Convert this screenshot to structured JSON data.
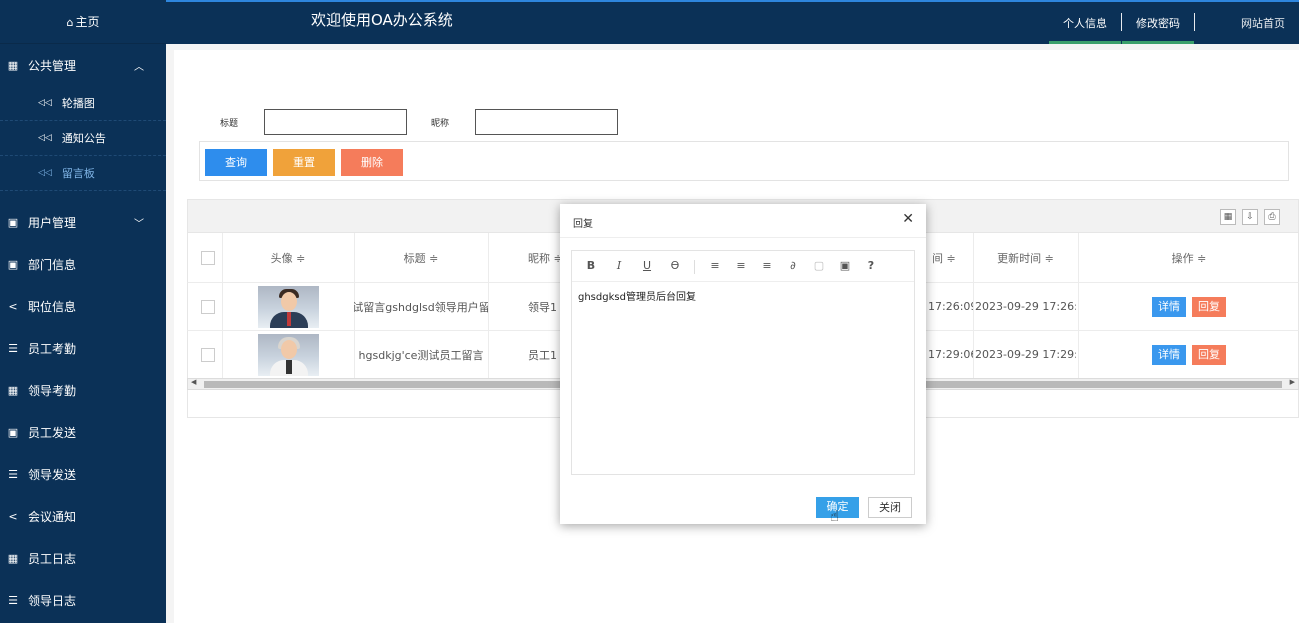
{
  "sidebar": {
    "home": "主页",
    "groups": [
      {
        "label": "公共管理",
        "icon": "grid-icon",
        "expanded": true
      },
      {
        "label": "用户管理",
        "icon": "calendar-icon",
        "expanded": false
      },
      {
        "label": "部门信息",
        "icon": "calendar-icon"
      },
      {
        "label": "职位信息",
        "icon": "share-icon"
      },
      {
        "label": "员工考勤",
        "icon": "list-icon"
      },
      {
        "label": "领导考勤",
        "icon": "grid-icon"
      },
      {
        "label": "员工发送",
        "icon": "calendar-icon"
      },
      {
        "label": "领导发送",
        "icon": "list-icon"
      },
      {
        "label": "会议通知",
        "icon": "share-icon"
      },
      {
        "label": "员工日志",
        "icon": "grid-icon"
      },
      {
        "label": "领导日志",
        "icon": "list-icon"
      }
    ],
    "sub_items": [
      "轮播图",
      "通知公告",
      "留言板"
    ],
    "active_sub": "留言板"
  },
  "header": {
    "title": "欢迎使用OA办公系统",
    "links": [
      "个人信息",
      "修改密码",
      "网站首页"
    ]
  },
  "search": {
    "title_label": "标题",
    "nickname_label": "昵称",
    "title_value": "",
    "nickname_value": "",
    "buttons": {
      "query": "查询",
      "reset": "重置",
      "delete": "删除"
    }
  },
  "table": {
    "columns": [
      "头像 ≑",
      "标题 ≑",
      "昵称 ≑",
      "间 ≑",
      "更新时间 ≑",
      "操作 ≑"
    ],
    "rows": [
      {
        "title": "试留言gshdglsd领导用户留",
        "nickname": "领导1",
        "created": "17:26:09",
        "updated": "2023-09-29 17:26:0",
        "detail": "详情",
        "reply": "回复"
      },
      {
        "title": "hgsdkjg'ce测试员工留言",
        "nickname": "员工1",
        "created": "17:29:06",
        "updated": "2023-09-29 17:29:0",
        "detail": "详情",
        "reply": "回复"
      }
    ]
  },
  "modal": {
    "title": "回复",
    "content": "ghsdgksd管理员后台回复",
    "ok_label": "确定",
    "close_label": "关闭",
    "toolbar": [
      "B",
      "I",
      "U",
      "S",
      "align-left",
      "align-center",
      "align-right",
      "link",
      "table",
      "image",
      "?"
    ]
  },
  "colors": {
    "sidebar_bg": "#0b3157",
    "query_btn": "#2e8ded",
    "reset_btn": "#f0a23a",
    "delete_btn": "#f57c5b",
    "detail_btn": "#3a98ee",
    "reply_btn": "#f57c5b"
  }
}
